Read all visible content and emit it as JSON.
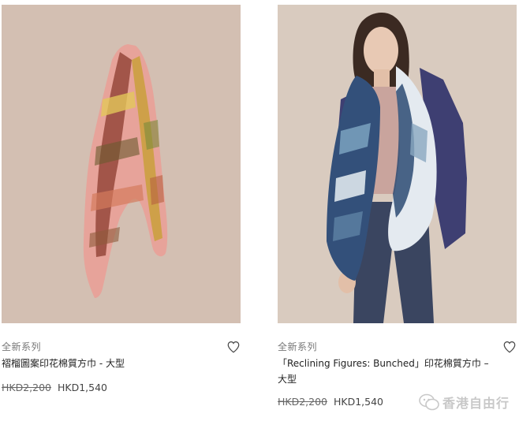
{
  "products": [
    {
      "collection": "全新系列",
      "name": "褶榴圖案印花棉質方巾 - 大型",
      "old_price": "HKD2,200",
      "new_price": "HKD1,540",
      "image_alt": "patterned scarf hanging on wall"
    },
    {
      "collection": "全新系列",
      "name": "「Reclining Figures: Bunched」印花棉質方巾 – 大型",
      "old_price": "HKD2,200",
      "new_price": "HKD1,540",
      "image_alt": "model wearing blue printed scarf"
    }
  ],
  "icons": {
    "wishlist": "heart-outline-icon",
    "watermark": "wechat-icon"
  },
  "watermark": {
    "text": "香港自由行"
  },
  "colors": {
    "photo_bg": "#d3bfb2",
    "scarf_pink": "#e7a39a",
    "scarf_blue": "#33507a"
  }
}
